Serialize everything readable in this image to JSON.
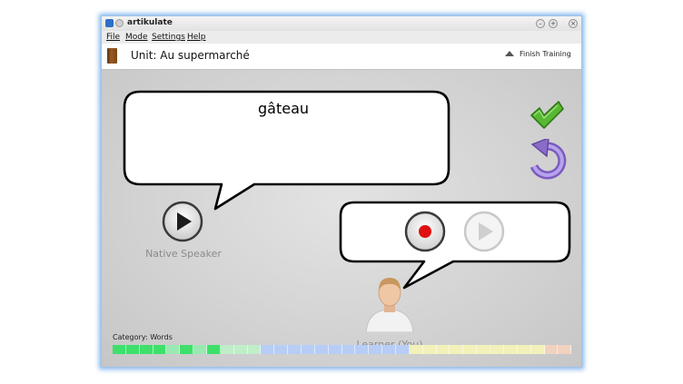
{
  "window": {
    "title": "artikulate"
  },
  "menu": {
    "items": [
      "File",
      "Mode",
      "Settings",
      "Help"
    ]
  },
  "toolbar": {
    "unit_title": "Unit: Au supermarché",
    "finish_label": "Finish Training"
  },
  "trainer": {
    "word": "gâteau",
    "native_label": "Native Speaker",
    "learner_label": "Learner (You)",
    "category": "Category: Words"
  },
  "progress": {
    "segments": [
      "#3ee06b",
      "#3ee06b",
      "#3ee06b",
      "#3ee06b",
      "#9be8b3",
      "#3ee06b",
      "#9be8b3",
      "#3ee06b",
      "#bfeec8",
      "#bfeec8",
      "#bfeec8",
      "#b7cdf5",
      "#b7cdf5",
      "#b7cdf5",
      "#b7cdf5",
      "#b7cdf5",
      "#b7cdf5",
      "#b7cdf5",
      "#b7cdf5",
      "#b7cdf5",
      "#b7cdf5",
      "#b7cdf5",
      "#f2f1b9",
      "#f2f1b9",
      "#f2f1b9",
      "#f2f1b9",
      "#f2f1b9",
      "#f2f1b9",
      "#f2f1b9",
      "#f2f1b9",
      "#f2f1b9",
      "#f2f1b9",
      "#f1d2bf",
      "#f1d2bf"
    ]
  },
  "colors": {
    "accent_check": "#4caf2a",
    "record_red": "#e01010",
    "repeat_purple": "#8a6cc8"
  },
  "icons": {
    "check": "checkmark-icon",
    "repeat": "repeat-icon",
    "play": "play-icon",
    "record": "record-icon",
    "book": "book-icon",
    "learner": "user-avatar-icon"
  }
}
